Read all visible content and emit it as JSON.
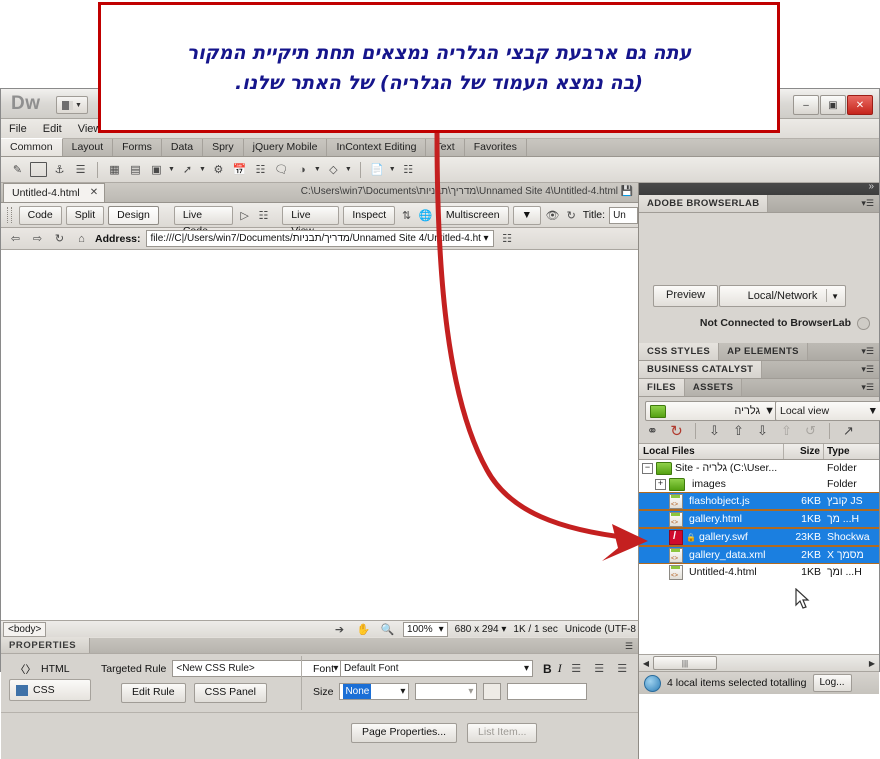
{
  "callout": {
    "line1": "עתה גם ארבעת קבצי הגלריה נמצאים תחת תיקיית המקור",
    "line2": "(בה נמצא העמוד של הגלריה) של האתר שלנו.",
    "border_color": "#c00000",
    "text_color": "#15158c",
    "arrow_color": "#c42020"
  },
  "app": {
    "logo": "Dw",
    "window_buttons": {
      "minimize": "–",
      "restore": "▣",
      "close": "✕"
    }
  },
  "menu": {
    "items": [
      "File",
      "Edit",
      "View"
    ]
  },
  "insert_panel": {
    "tabs": [
      "Common",
      "Layout",
      "Forms",
      "Data",
      "Spry",
      "jQuery Mobile",
      "InContext Editing",
      "Text",
      "Favorites"
    ],
    "active_tab": "Common",
    "icons": [
      "hyperlink-icon",
      "email-link-icon",
      "anchor-icon",
      "horizontal-rule-icon",
      "table-icon",
      "insert-div-icon",
      "image-icon",
      "media-icon",
      "widget-icon",
      "date-icon",
      "server-side-include-icon",
      "comment-icon",
      "head-tag-icon",
      "script-icon",
      "template-icon",
      "tag-chooser-icon"
    ]
  },
  "document": {
    "tab_label": "Untitled-4.html",
    "tab_close": "✕",
    "path": "C:\\Users\\win7\\Documents\\מדריך\\תבניות\\Unnamed Site 4\\Untitled-4.html",
    "toolbar": {
      "code": "Code",
      "split": "Split",
      "design": "Design",
      "live_code": "Live Code",
      "live_view": "Live View",
      "inspect": "Inspect",
      "multiscreen": "Multiscreen",
      "title_label": "Title:",
      "title_value": "Un"
    },
    "address": {
      "label": "Address:",
      "value": "file:///C|/Users/win7/Documents/מדריך/תבניות/Unnamed Site 4/Untitled-4.ht"
    },
    "status": {
      "tag_selector": "<body>",
      "zoom": "100%",
      "dimensions": "680 x 294",
      "download": "1K / 1 sec",
      "encoding": "Unicode (UTF-8"
    }
  },
  "properties": {
    "title": "PROPERTIES",
    "html_label": "HTML",
    "css_label": "CSS",
    "targeted_rule_label": "Targeted Rule",
    "targeted_rule_value": "<New CSS Rule>",
    "edit_rule": "Edit Rule",
    "css_panel": "CSS Panel",
    "font_label": "Font",
    "font_value": "Default Font",
    "size_label": "Size",
    "size_value": "None",
    "bold": "B",
    "italic": "I",
    "page_properties": "Page Properties...",
    "list_item": "List Item..."
  },
  "browserlab": {
    "panel_title": "ADOBE BROWSERLAB",
    "preview": "Preview",
    "location": "Local/Network",
    "status": "Not Connected to BrowserLab"
  },
  "css_styles_panel": {
    "tab1": "CSS STYLES",
    "tab2": "AP ELEMENTS"
  },
  "business_catalyst": {
    "title": "BUSINESS CATALYST"
  },
  "files_panel": {
    "tab1": "FILES",
    "tab2": "ASSETS",
    "site_selector": "גלריה",
    "view_selector": "Local view",
    "toolbar_icons": [
      "connect-icon",
      "refresh-icon",
      "get-files-icon",
      "put-files-icon",
      "check-out-icon",
      "check-in-icon",
      "synchronize-icon",
      "expand-icon"
    ],
    "columns": {
      "name": "Local Files",
      "size": "Size",
      "type": "Type"
    },
    "rows": [
      {
        "name": "Site - גלריה (C:\\User...",
        "size": "",
        "type": "Folder",
        "icon": "folder-icon",
        "indent": 0,
        "selected": false,
        "twisty": "−"
      },
      {
        "name": "images",
        "size": "",
        "type": "Folder",
        "icon": "folder-icon",
        "indent": 1,
        "selected": false,
        "twisty": "+"
      },
      {
        "name": "flashobject.js",
        "size": "6KB",
        "type": "JS קובץ",
        "icon": "js-file-icon",
        "indent": 1,
        "selected": true,
        "twisty": ""
      },
      {
        "name": "gallery.html",
        "size": "1KB",
        "type": "H... מך",
        "icon": "html-file-icon",
        "indent": 1,
        "selected": true,
        "twisty": ""
      },
      {
        "name": "gallery.swf",
        "size": "23KB",
        "type": "Shockwa",
        "icon": "swf-file-icon",
        "indent": 1,
        "selected": true,
        "twisty": "",
        "locked": true
      },
      {
        "name": "gallery_data.xml",
        "size": "2KB",
        "type": "מסמך X",
        "icon": "xml-file-icon",
        "indent": 1,
        "selected": true,
        "twisty": ""
      },
      {
        "name": "Untitled-4.html",
        "size": "1KB",
        "type": "H... ומך",
        "icon": "html-file-icon",
        "indent": 1,
        "selected": false,
        "twisty": ""
      }
    ],
    "status_text": "4 local items selected totalling",
    "log_button": "Log...",
    "selection_color": "#1b7fe0"
  }
}
